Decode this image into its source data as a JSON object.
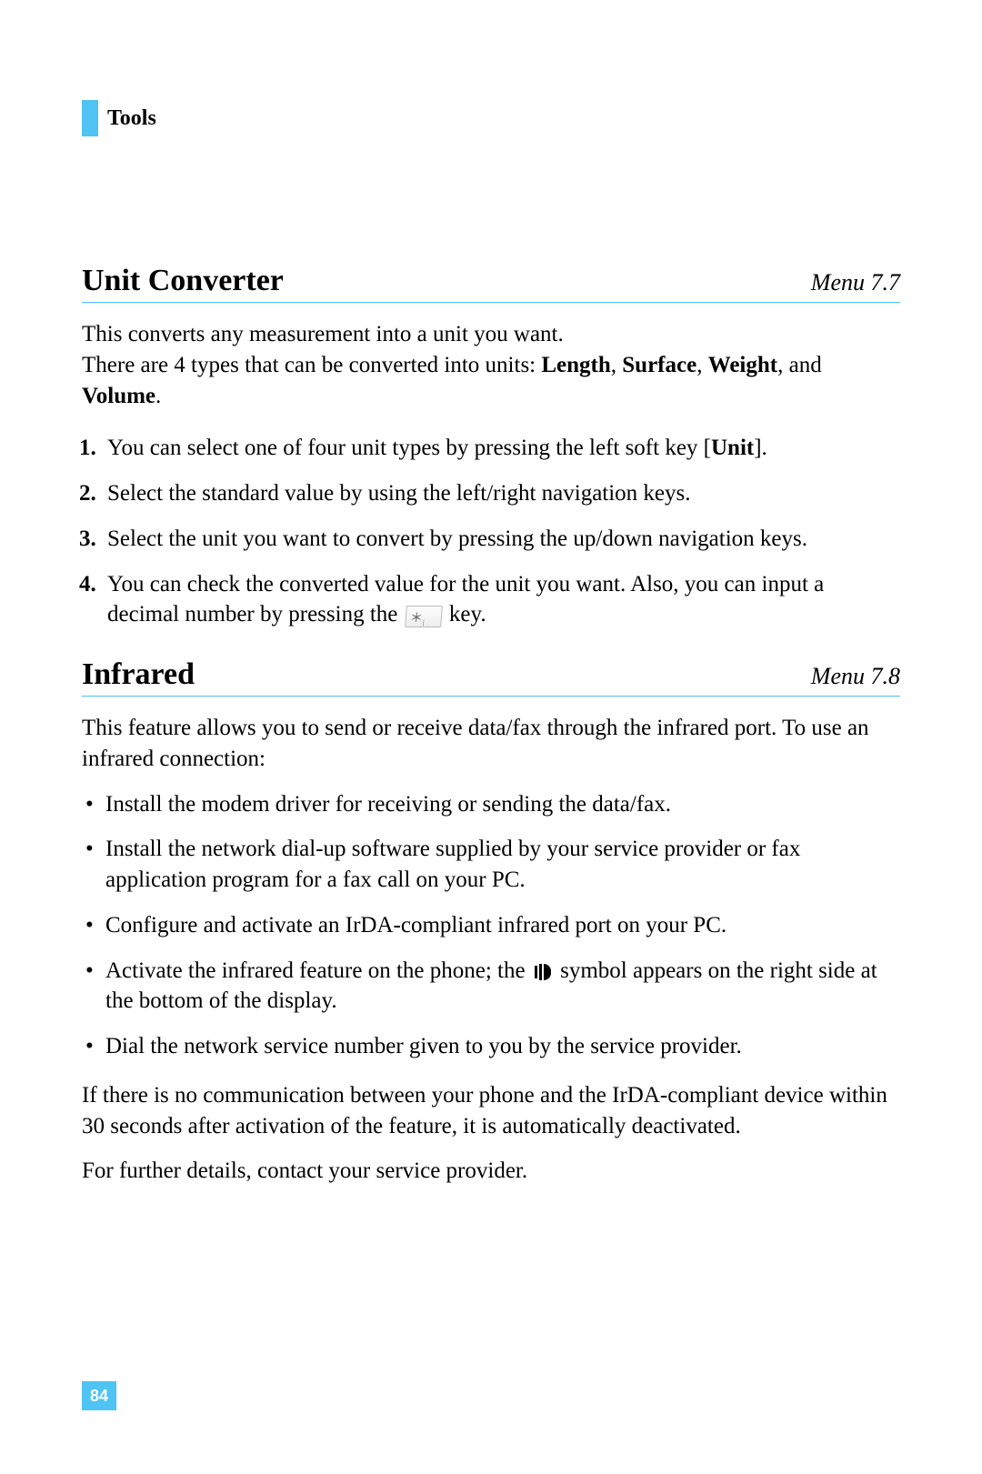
{
  "header": {
    "title": "Tools"
  },
  "section1": {
    "title": "Unit Converter",
    "menu": "Menu 7.7",
    "intro_plain1": "This converts any measurement into a unit you want.",
    "intro_plain2a": "There are 4 types that can be converted into units: ",
    "types": {
      "length": "Length",
      "surface": "Surface",
      "weight": "Weight",
      "volume": "Volume"
    },
    "ol": {
      "i1a": "You can select one of four unit types by pressing the left soft key [",
      "unit_bold": "Unit",
      "i1b": "].",
      "i2": "Select the standard value by using the left/right navigation keys.",
      "i3": "Select the unit you want to convert by pressing the up/down navigation keys.",
      "i4a": "You can check the converted value for the unit you want. Also, you can input a decimal number by pressing the ",
      "key_label": "＊",
      "i4b": " key."
    }
  },
  "section2": {
    "title": "Infrared",
    "menu": "Menu 7.8",
    "intro": "This feature allows you to send or receive data/fax through the infrared port. To use an infrared connection:",
    "ul": {
      "b1": "Install the modem driver for receiving or sending the data/fax.",
      "b2": "Install the network dial-up software supplied by your service provider or fax application program for a fax call on your PC.",
      "b3": "Configure and activate an IrDA-compliant infrared port on your PC.",
      "b4a": "Activate the infrared feature on the phone; the ",
      "b4b": " symbol appears on the right side at the bottom of the display.",
      "b5": "Dial the network service number given to you by the service provider."
    },
    "p_after1": "If there is no communication between your phone and the IrDA-compliant device within 30 seconds after activation of the feature, it is automatically deactivated.",
    "p_after2": "For further details, contact your service provider."
  },
  "page_number": "84",
  "misc": {
    "comma_sep": ", ",
    "and": ", and ",
    "period": "."
  }
}
